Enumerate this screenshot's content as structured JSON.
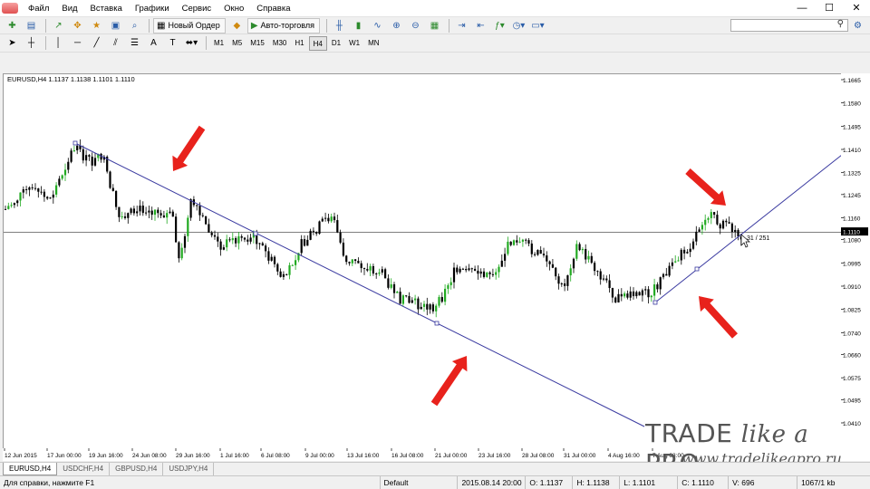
{
  "menu": {
    "items": [
      "Файл",
      "Вид",
      "Вставка",
      "Графики",
      "Сервис",
      "Окно",
      "Справка"
    ],
    "window_controls": {
      "minimize": "—",
      "maximize": "☐",
      "close": "✕"
    }
  },
  "toolbar": {
    "new_order_label": "Новый Ордер",
    "autotrading_label": "Авто-торговля",
    "timeframes": [
      "M1",
      "M5",
      "M15",
      "M30",
      "H1",
      "H4",
      "D1",
      "W1",
      "MN"
    ],
    "active_timeframe": "H4",
    "search": {
      "value": "",
      "placeholder": ""
    }
  },
  "chart": {
    "header_text": "EURUSD,H4  1.1137 1.1138 1.1101 1.1110",
    "crosshair_label": "31 / 251",
    "current_price_label": "1.1110",
    "trendline_color": "#3a3aa0",
    "arrow_color": "#e8221c",
    "candle_up_color": "#22aa22",
    "candle_down_color": "#000000"
  },
  "price_scale": [
    "1.1665",
    "1.1580",
    "1.1495",
    "1.1410",
    "1.1325",
    "1.1245",
    "1.1160",
    "1.1080",
    "1.0995",
    "1.0910",
    "1.0825",
    "1.0740",
    "1.0660",
    "1.0575",
    "1.0495",
    "1.0410"
  ],
  "time_scale": [
    "12 Jun 2015",
    "17 Jun 00:00",
    "19 Jun 16:00",
    "24 Jun 08:00",
    "29 Jun 16:00",
    "1 Jul 16:00",
    "6 Jul 08:00",
    "9 Jul 00:00",
    "13 Jul 16:00",
    "16 Jul 08:00",
    "21 Jul 00:00",
    "23 Jul 16:00",
    "28 Jul 08:00",
    "31 Jul 00:00",
    "4 Aug 16:00",
    "7 Aug 08:00"
  ],
  "tabs": [
    "EURUSD,H4",
    "USDCHF,H4",
    "GBPUSD,H4",
    "USDJPY,H4"
  ],
  "active_tab": "EURUSD,H4",
  "watermark": {
    "brand_1": "TRADE ",
    "brand_2": "like a",
    "brand_3": " PRO",
    "url": "www.tradelikeapro.ru"
  },
  "statusbar": {
    "help": "Для справки, нажмите F1",
    "profile": "Default",
    "datetime": "2015.08.14 20:00",
    "open": "O: 1.1137",
    "high": "H: 1.1138",
    "low": "L: 1.1101",
    "close": "C: 1.1110",
    "volume": "V: 696",
    "connection": "1067/1 kb"
  }
}
